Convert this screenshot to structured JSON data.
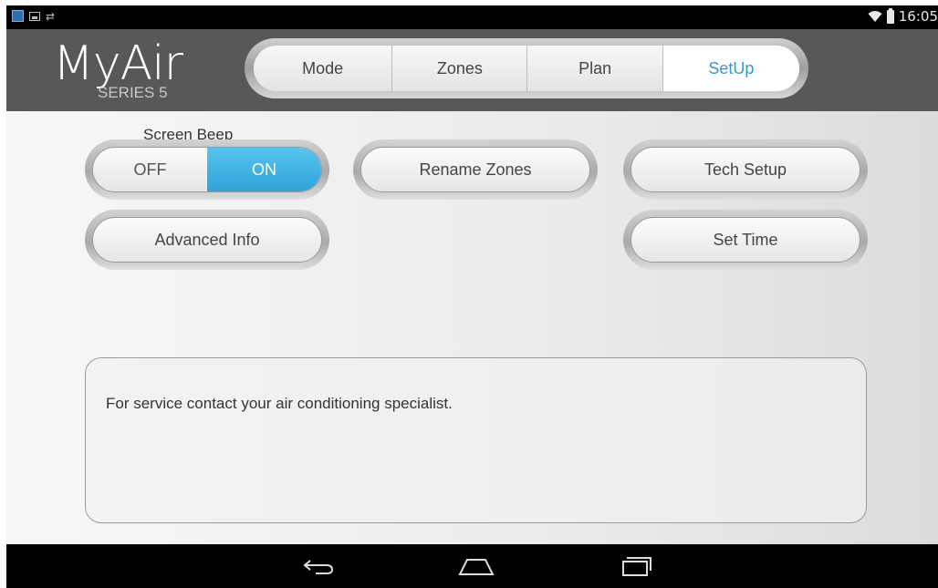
{
  "status_bar": {
    "time": "16:05",
    "icons_left": [
      "app-notification-icon",
      "image-notification-icon",
      "sync-icon"
    ],
    "icons_right": [
      "wifi-icon",
      "battery-icon"
    ]
  },
  "header": {
    "logo_title": "MyAir",
    "logo_subtitle": "SERIES 5",
    "tabs": [
      {
        "label": "Mode",
        "active": false
      },
      {
        "label": "Zones",
        "active": false
      },
      {
        "label": "Plan",
        "active": false
      },
      {
        "label": "SetUp",
        "active": true
      }
    ],
    "active_color": "#3a96d1"
  },
  "setup": {
    "screen_beep_label": "Screen Beep",
    "beep_off_label": "OFF",
    "beep_on_label": "ON",
    "beep_state": "ON",
    "rename_zones_label": "Rename Zones",
    "tech_setup_label": "Tech Setup",
    "advanced_info_label": "Advanced Info",
    "set_time_label": "Set Time",
    "service_message": "For service contact your air conditioning specialist."
  },
  "nav_bar": {
    "buttons": [
      "back-icon",
      "home-icon",
      "recent-apps-icon"
    ]
  },
  "colors": {
    "header_bg": "#585858",
    "toggle_on": "#2ea3da"
  }
}
